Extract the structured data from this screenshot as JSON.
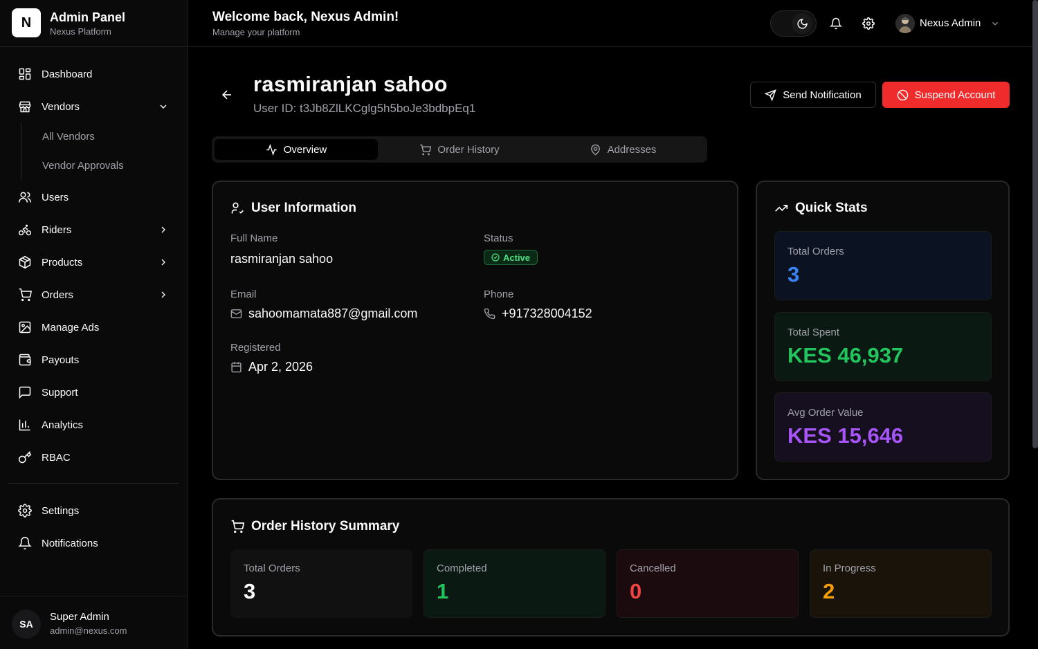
{
  "brand": {
    "logo_letter": "N",
    "title": "Admin Panel",
    "subtitle": "Nexus Platform"
  },
  "sidebar": {
    "items": [
      {
        "label": "Dashboard",
        "icon": "dashboard-icon"
      },
      {
        "label": "Vendors",
        "icon": "store-icon",
        "expanded": true
      },
      {
        "label": "Users",
        "icon": "users-icon"
      },
      {
        "label": "Riders",
        "icon": "bike-icon"
      },
      {
        "label": "Products",
        "icon": "package-icon"
      },
      {
        "label": "Orders",
        "icon": "cart-icon"
      },
      {
        "label": "Manage Ads",
        "icon": "image-icon"
      },
      {
        "label": "Payouts",
        "icon": "wallet-icon"
      },
      {
        "label": "Support",
        "icon": "message-icon"
      },
      {
        "label": "Analytics",
        "icon": "chart-icon"
      },
      {
        "label": "RBAC",
        "icon": "key-icon"
      },
      {
        "label": "Settings",
        "icon": "gear-icon"
      },
      {
        "label": "Notifications",
        "icon": "bell-icon"
      }
    ],
    "vendor_sub": [
      "All Vendors",
      "Vendor Approvals"
    ],
    "footer": {
      "initials": "SA",
      "name": "Super Admin",
      "email": "admin@nexus.com"
    }
  },
  "header": {
    "title": "Welcome back, Nexus Admin!",
    "subtitle": "Manage your platform",
    "user_name": "Nexus Admin"
  },
  "page": {
    "title": "rasmiranjan sahoo",
    "user_id": "User ID: t3Jb8ZlLKCglg5h5boJe3bdbpEq1",
    "send_notification": "Send Notification",
    "suspend_account": "Suspend Account"
  },
  "tabs": [
    {
      "label": "Overview",
      "active": true
    },
    {
      "label": "Order History",
      "active": false
    },
    {
      "label": "Addresses",
      "active": false
    }
  ],
  "user_info": {
    "title": "User Information",
    "full_name_label": "Full Name",
    "full_name": "rasmiranjan sahoo",
    "status_label": "Status",
    "status": "Active",
    "email_label": "Email",
    "email": "sahoomamata887@gmail.com",
    "phone_label": "Phone",
    "phone": "+917328004152",
    "registered_label": "Registered",
    "registered": "Apr 2, 2026"
  },
  "quick_stats": {
    "title": "Quick Stats",
    "items": [
      {
        "label": "Total Orders",
        "value": "3",
        "color": "#3b82f6"
      },
      {
        "label": "Total Spent",
        "value": "KES 46,937",
        "color": "#22c55e"
      },
      {
        "label": "Avg Order Value",
        "value": "KES 15,646",
        "color": "#a855f7"
      }
    ]
  },
  "order_summary": {
    "title": "Order History Summary",
    "items": [
      {
        "label": "Total Orders",
        "value": "3",
        "color": "#ffffff"
      },
      {
        "label": "Completed",
        "value": "1",
        "color": "#22c55e"
      },
      {
        "label": "Cancelled",
        "value": "0",
        "color": "#ef4444"
      },
      {
        "label": "In Progress",
        "value": "2",
        "color": "#f59e0b"
      }
    ]
  },
  "colors": {
    "accent_red": "#ef2b2b",
    "status_green": "#4ade80"
  }
}
